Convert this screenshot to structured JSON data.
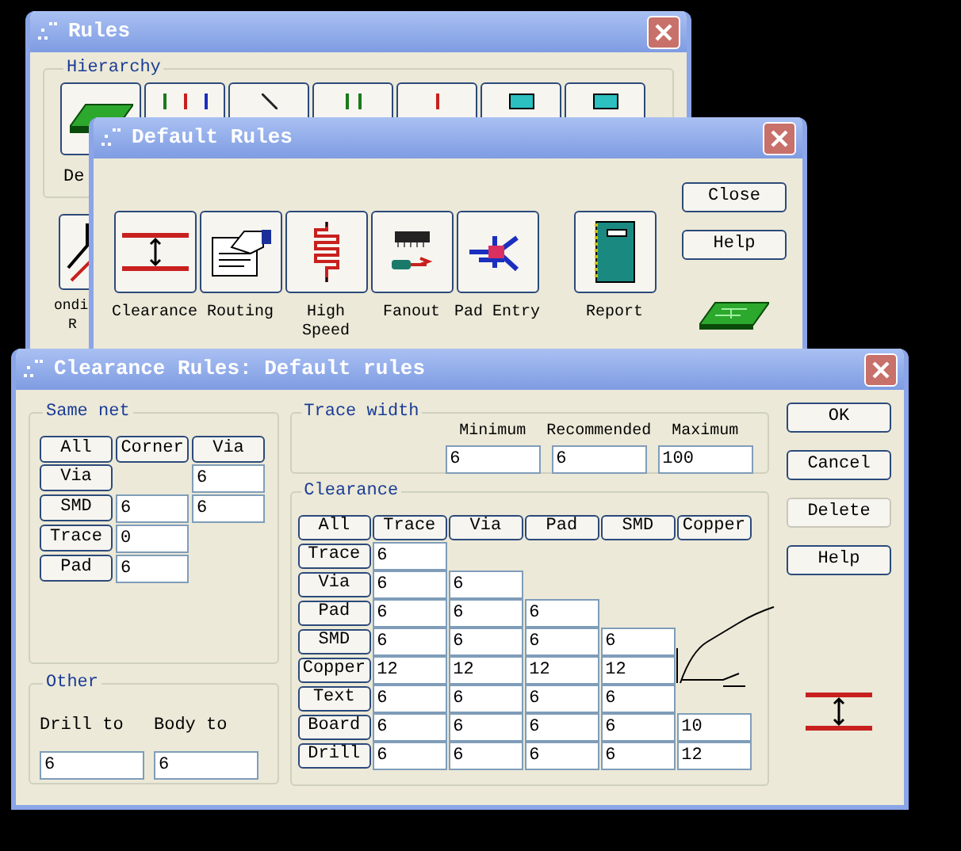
{
  "rules_window": {
    "title": "Rules",
    "group": "Hierarchy",
    "button_label": "De",
    "second_label_lines": [
      "ondi",
      "R"
    ]
  },
  "default_rules_window": {
    "title": "Default Rules",
    "rule_buttons": [
      {
        "label": "Clearance"
      },
      {
        "label": "Routing"
      },
      {
        "label": "High Speed"
      },
      {
        "label": "Fanout"
      },
      {
        "label": "Pad Entry"
      },
      {
        "label": "Report"
      }
    ],
    "buttons": [
      {
        "label": "Close"
      },
      {
        "label": "Help"
      }
    ]
  },
  "clearance_window": {
    "title": "Clearance Rules: Default rules",
    "same_net": {
      "legend": "Same net",
      "all": "All",
      "columns": [
        "Corner",
        "Via"
      ],
      "rows": [
        {
          "label": "Via",
          "cells": [
            null,
            "6"
          ]
        },
        {
          "label": "SMD",
          "cells": [
            "6",
            "6"
          ]
        },
        {
          "label": "Trace",
          "cells": [
            "0"
          ]
        },
        {
          "label": "Pad",
          "cells": [
            "6"
          ]
        }
      ]
    },
    "other": {
      "legend": "Other",
      "fields": [
        {
          "label": "Drill to",
          "value": "6"
        },
        {
          "label": "Body to",
          "value": "6"
        }
      ]
    },
    "trace_width": {
      "legend": "Trace width",
      "fields": [
        {
          "label": "Minimum",
          "value": "6"
        },
        {
          "label": "Recommended",
          "value": "6"
        },
        {
          "label": "Maximum",
          "value": "100"
        }
      ]
    },
    "clearance": {
      "legend": "Clearance",
      "all": "All",
      "columns": [
        "Trace",
        "Via",
        "Pad",
        "SMD",
        "Copper"
      ],
      "rows": [
        {
          "label": "Trace",
          "cells": [
            "6"
          ]
        },
        {
          "label": "Via",
          "cells": [
            "6",
            "6"
          ]
        },
        {
          "label": "Pad",
          "cells": [
            "6",
            "6",
            "6"
          ]
        },
        {
          "label": "SMD",
          "cells": [
            "6",
            "6",
            "6",
            "6"
          ]
        },
        {
          "label": "Copper",
          "cells": [
            "12",
            "12",
            "12",
            "12"
          ]
        },
        {
          "label": "Text",
          "cells": [
            "6",
            "6",
            "6",
            "6"
          ]
        },
        {
          "label": "Board",
          "cells": [
            "6",
            "6",
            "6",
            "6",
            "10"
          ]
        },
        {
          "label": "Drill",
          "cells": [
            "6",
            "6",
            "6",
            "6",
            "12"
          ]
        }
      ]
    },
    "buttons": [
      {
        "label": "OK",
        "disabled": false
      },
      {
        "label": "Cancel",
        "disabled": false
      },
      {
        "label": "Delete",
        "disabled": true
      },
      {
        "label": "Help",
        "disabled": false
      }
    ]
  }
}
